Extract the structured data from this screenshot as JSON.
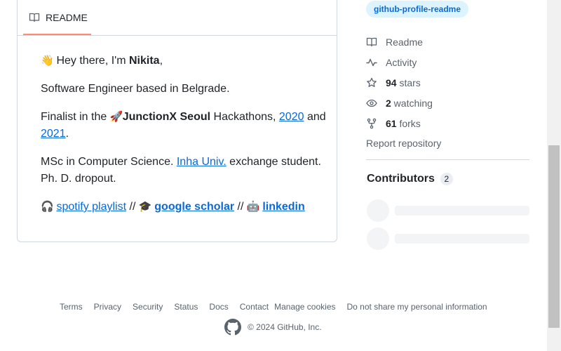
{
  "readme": {
    "tab_label": "README",
    "greeting_prefix": "Hey there, I'm ",
    "greeting_name": "Nikita",
    "greeting_suffix": ",",
    "role": "Software Engineer based in Belgrade.",
    "finalist_prefix": "Finalist in the ",
    "finalist_event": "JunctionX Seoul",
    "finalist_mid": " Hackathons, ",
    "year_2020": "2020",
    "and_text": "and",
    "year_2021": "2021",
    "period": ".",
    "msc_prefix": "MSc in Computer Science. ",
    "msc_link": "Inha Univ.",
    "msc_suffix": " exchange student.",
    "phd": "Ph. D. dropout.",
    "spotify": "spotify playlist",
    "sep": " // ",
    "scholar": "google scholar",
    "linkedin": "linkedin",
    "emojis": {
      "wave": "👋",
      "rocket": "🚀",
      "headphones": "🎧",
      "cap": "🎓",
      "robot": "🤖"
    }
  },
  "sidebar": {
    "topic": "github-profile-readme",
    "items": [
      {
        "icon": "book-icon",
        "count": "",
        "label": "Readme"
      },
      {
        "icon": "pulse-icon",
        "count": "",
        "label": "Activity"
      },
      {
        "icon": "star-icon",
        "count": "94",
        "label": " stars"
      },
      {
        "icon": "eye-icon",
        "count": "2",
        "label": " watching"
      },
      {
        "icon": "fork-icon",
        "count": "61",
        "label": " forks"
      }
    ],
    "report": "Report repository",
    "contributors_title": "Contributors",
    "contributors_count": "2"
  },
  "footer": {
    "links": [
      "Terms",
      "Privacy",
      "Security",
      "Status",
      "Docs",
      "Contact",
      "Manage cookies",
      "Do not share my personal information"
    ],
    "copyright": "© 2024 GitHub, Inc."
  },
  "colors": {
    "link": "#0969da",
    "accent_tab": "#fd8c73",
    "topic_bg": "#ddf4ff"
  }
}
